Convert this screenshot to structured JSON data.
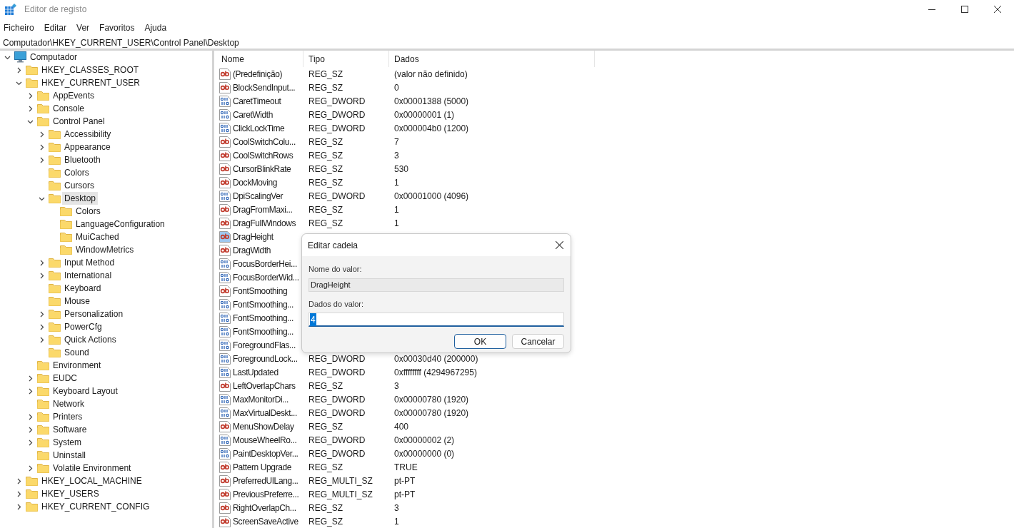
{
  "window": {
    "title": "Editor de registo"
  },
  "menu": [
    "Ficheiro",
    "Editar",
    "Ver",
    "Favoritos",
    "Ajuda"
  ],
  "address": "Computador\\HKEY_CURRENT_USER\\Control Panel\\Desktop",
  "tree": {
    "label": "Computador",
    "kind": "computer",
    "expanded": true,
    "selected": false,
    "children": [
      {
        "label": "HKEY_CLASSES_ROOT",
        "kind": "folder",
        "expanded": false,
        "selected": false
      },
      {
        "label": "HKEY_CURRENT_USER",
        "kind": "folder",
        "expanded": true,
        "selected": false,
        "children": [
          {
            "label": "AppEvents",
            "kind": "folder",
            "expanded": false,
            "selected": false
          },
          {
            "label": "Console",
            "kind": "folder",
            "expanded": false,
            "selected": false
          },
          {
            "label": "Control Panel",
            "kind": "folder",
            "expanded": true,
            "selected": false,
            "children": [
              {
                "label": "Accessibility",
                "kind": "folder",
                "expanded": false,
                "selected": false
              },
              {
                "label": "Appearance",
                "kind": "folder",
                "expanded": false,
                "selected": false
              },
              {
                "label": "Bluetooth",
                "kind": "folder",
                "expanded": false,
                "selected": false
              },
              {
                "label": "Colors",
                "kind": "folder",
                "selected": false
              },
              {
                "label": "Cursors",
                "kind": "folder",
                "selected": false
              },
              {
                "label": "Desktop",
                "kind": "folder",
                "expanded": true,
                "selected": true,
                "children": [
                  {
                    "label": "Colors",
                    "kind": "folder",
                    "selected": false
                  },
                  {
                    "label": "LanguageConfiguration",
                    "kind": "folder",
                    "selected": false
                  },
                  {
                    "label": "MuiCached",
                    "kind": "folder",
                    "selected": false
                  },
                  {
                    "label": "WindowMetrics",
                    "kind": "folder",
                    "selected": false
                  }
                ]
              },
              {
                "label": "Input Method",
                "kind": "folder",
                "expanded": false,
                "selected": false
              },
              {
                "label": "International",
                "kind": "folder",
                "expanded": false,
                "selected": false
              },
              {
                "label": "Keyboard",
                "kind": "folder",
                "selected": false
              },
              {
                "label": "Mouse",
                "kind": "folder",
                "selected": false
              },
              {
                "label": "Personalization",
                "kind": "folder",
                "expanded": false,
                "selected": false
              },
              {
                "label": "PowerCfg",
                "kind": "folder",
                "expanded": false,
                "selected": false
              },
              {
                "label": "Quick Actions",
                "kind": "folder",
                "expanded": false,
                "selected": false
              },
              {
                "label": "Sound",
                "kind": "folder",
                "selected": false
              }
            ]
          },
          {
            "label": "Environment",
            "kind": "folder",
            "selected": false
          },
          {
            "label": "EUDC",
            "kind": "folder",
            "expanded": false,
            "selected": false
          },
          {
            "label": "Keyboard Layout",
            "kind": "folder",
            "expanded": false,
            "selected": false
          },
          {
            "label": "Network",
            "kind": "folder",
            "selected": false
          },
          {
            "label": "Printers",
            "kind": "folder",
            "expanded": false,
            "selected": false
          },
          {
            "label": "Software",
            "kind": "folder",
            "expanded": false,
            "selected": false
          },
          {
            "label": "System",
            "kind": "folder",
            "expanded": false,
            "selected": false
          },
          {
            "label": "Uninstall",
            "kind": "folder",
            "selected": false
          },
          {
            "label": "Volatile Environment",
            "kind": "folder",
            "expanded": false,
            "selected": false
          }
        ]
      },
      {
        "label": "HKEY_LOCAL_MACHINE",
        "kind": "folder",
        "expanded": false,
        "selected": false
      },
      {
        "label": "HKEY_USERS",
        "kind": "folder",
        "expanded": false,
        "selected": false
      },
      {
        "label": "HKEY_CURRENT_CONFIG",
        "kind": "folder",
        "expanded": false,
        "selected": false
      }
    ]
  },
  "list": {
    "columns": [
      "Nome",
      "Tipo",
      "Dados"
    ],
    "rows": [
      {
        "kind": "string",
        "name": "(Predefinição)",
        "type": "REG_SZ",
        "data": "(valor não definido)",
        "selected": false
      },
      {
        "kind": "string",
        "name": "BlockSendInput...",
        "type": "REG_SZ",
        "data": "0",
        "selected": false
      },
      {
        "kind": "binary",
        "name": "CaretTimeout",
        "type": "REG_DWORD",
        "data": "0x00001388 (5000)",
        "selected": false
      },
      {
        "kind": "binary",
        "name": "CaretWidth",
        "type": "REG_DWORD",
        "data": "0x00000001 (1)",
        "selected": false
      },
      {
        "kind": "binary",
        "name": "ClickLockTime",
        "type": "REG_DWORD",
        "data": "0x000004b0 (1200)",
        "selected": false
      },
      {
        "kind": "string",
        "name": "CoolSwitchColu...",
        "type": "REG_SZ",
        "data": "7",
        "selected": false
      },
      {
        "kind": "string",
        "name": "CoolSwitchRows",
        "type": "REG_SZ",
        "data": "3",
        "selected": false
      },
      {
        "kind": "string",
        "name": "CursorBlinkRate",
        "type": "REG_SZ",
        "data": "530",
        "selected": false
      },
      {
        "kind": "string",
        "name": "DockMoving",
        "type": "REG_SZ",
        "data": "1",
        "selected": false
      },
      {
        "kind": "binary",
        "name": "DpiScalingVer",
        "type": "REG_DWORD",
        "data": "0x00001000 (4096)",
        "selected": false
      },
      {
        "kind": "string",
        "name": "DragFromMaxi...",
        "type": "REG_SZ",
        "data": "1",
        "selected": false
      },
      {
        "kind": "string",
        "name": "DragFullWindows",
        "type": "REG_SZ",
        "data": "1",
        "selected": false
      },
      {
        "kind": "string",
        "name": "DragHeight",
        "selected": true
      },
      {
        "kind": "string",
        "name": "DragWidth",
        "selected": false
      },
      {
        "kind": "binary",
        "name": "FocusBorderHei...",
        "selected": false
      },
      {
        "kind": "binary",
        "name": "FocusBorderWid...",
        "selected": false
      },
      {
        "kind": "string",
        "name": "FontSmoothing",
        "selected": false
      },
      {
        "kind": "binary",
        "name": "FontSmoothing...",
        "selected": false
      },
      {
        "kind": "binary",
        "name": "FontSmoothing...",
        "selected": false
      },
      {
        "kind": "binary",
        "name": "FontSmoothing...",
        "selected": false
      },
      {
        "kind": "binary",
        "name": "ForegroundFlas...",
        "selected": false
      },
      {
        "kind": "binary",
        "name": "ForegroundLock...",
        "type": "REG_DWORD",
        "data": "0x00030d40 (200000)",
        "selected": false
      },
      {
        "kind": "binary",
        "name": "LastUpdated",
        "type": "REG_DWORD",
        "data": "0xffffffff (4294967295)",
        "selected": false
      },
      {
        "kind": "string",
        "name": "LeftOverlapChars",
        "type": "REG_SZ",
        "data": "3",
        "selected": false
      },
      {
        "kind": "binary",
        "name": "MaxMonitorDi...",
        "type": "REG_DWORD",
        "data": "0x00000780 (1920)",
        "selected": false
      },
      {
        "kind": "binary",
        "name": "MaxVirtualDeskt...",
        "type": "REG_DWORD",
        "data": "0x00000780 (1920)",
        "selected": false
      },
      {
        "kind": "string",
        "name": "MenuShowDelay",
        "type": "REG_SZ",
        "data": "400",
        "selected": false
      },
      {
        "kind": "binary",
        "name": "MouseWheelRo...",
        "type": "REG_DWORD",
        "data": "0x00000002 (2)",
        "selected": false
      },
      {
        "kind": "binary",
        "name": "PaintDesktopVer...",
        "type": "REG_DWORD",
        "data": "0x00000000 (0)",
        "selected": false
      },
      {
        "kind": "string",
        "name": "Pattern Upgrade",
        "type": "REG_SZ",
        "data": "TRUE",
        "selected": false
      },
      {
        "kind": "string",
        "name": "PreferredUILang...",
        "type": "REG_MULTI_SZ",
        "data": "pt-PT",
        "selected": false
      },
      {
        "kind": "string",
        "name": "PreviousPreferre...",
        "type": "REG_MULTI_SZ",
        "data": "pt-PT",
        "selected": false
      },
      {
        "kind": "string",
        "name": "RightOverlapCh...",
        "type": "REG_SZ",
        "data": "3",
        "selected": false
      },
      {
        "kind": "string",
        "name": "ScreenSaveActive",
        "type": "REG_SZ",
        "data": "1",
        "selected": false
      }
    ]
  },
  "dialog": {
    "title": "Editar cadeia",
    "name_label": "Nome do valor:",
    "name_value": "DragHeight",
    "data_label": "Dados do valor:",
    "data_value": "4",
    "buttons": [
      {
        "label": "OK",
        "default": true
      },
      {
        "label": "Cancelar",
        "default": false
      }
    ]
  }
}
